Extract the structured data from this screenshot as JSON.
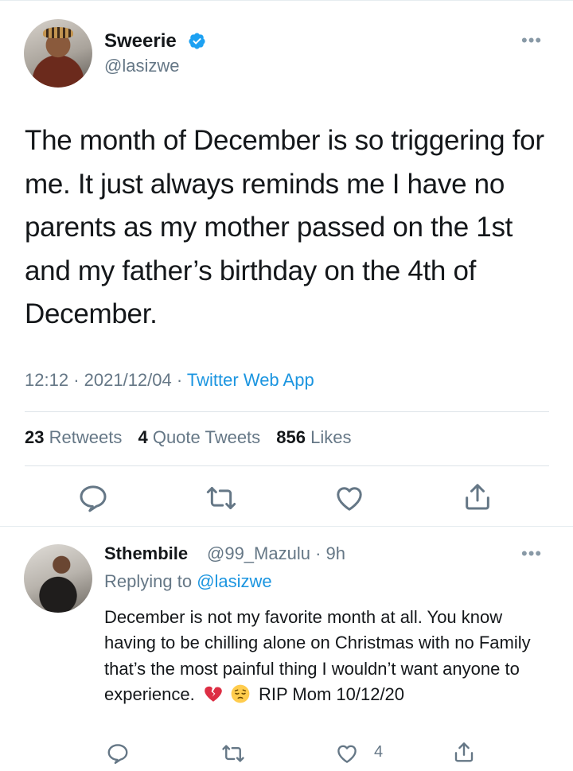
{
  "tweet": {
    "author_name": "Sweerie",
    "author_handle": "@lasizwe",
    "text": "The month of December is so triggering for me. It just always reminds me I have no parents as my mother passed on the 1st and my father’s birthday on the 4th of December.",
    "time": "12:12",
    "date": "2021/12/04",
    "app": "Twitter Web App",
    "separator": "·",
    "stats": {
      "retweets_count": "23",
      "retweets_label": "Retweets",
      "quote_count": "4",
      "quote_label": "Quote Tweets",
      "likes_count": "856",
      "likes_label": "Likes"
    },
    "more_symbol": "•••"
  },
  "reply": {
    "author_name": "Sthembile",
    "author_handle": "@99_Mazulu · 9h",
    "replying_prefix": "Replying to",
    "replying_to": "@lasizwe",
    "text_before_emoji": "December is not my favorite month at all. You know having to be chilling alone on Christmas with no Family that’s the most painful thing I wouldn’t want anyone to experience.",
    "text_after_emoji": "RIP Mom 10/12/20",
    "like_count": "4",
    "more_symbol": "•••"
  },
  "icons": {
    "verified": "verified-badge-icon",
    "reply": "reply-icon",
    "retweet": "retweet-icon",
    "like": "heart-icon",
    "share": "share-icon",
    "broken_heart": "broken-heart-emoji",
    "pensive": "pensive-face-emoji"
  },
  "colors": {
    "link": "#1b95e0",
    "secondary_text": "#657786",
    "primary_text": "#14171a",
    "verified_blue": "#1da1f2"
  }
}
